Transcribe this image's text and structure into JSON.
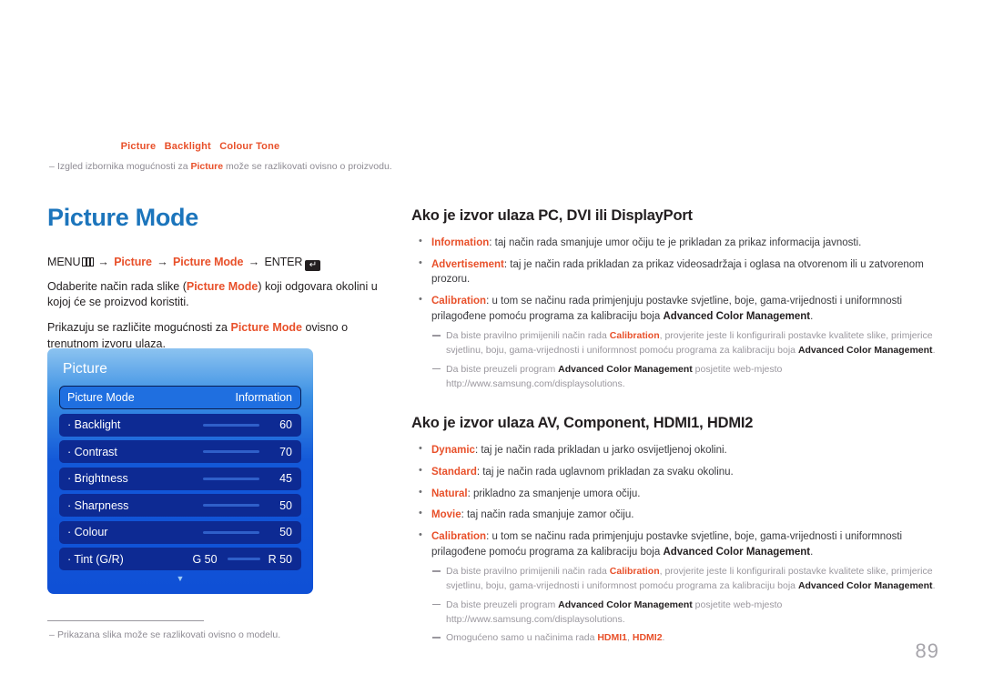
{
  "runhead": {
    "items": [
      "Picture",
      "Backlight",
      "Colour Tone"
    ],
    "color": "#e8502a"
  },
  "topnote": {
    "dash": "–",
    "before": "Izgled izbornika mogućnosti za ",
    "keyword": "Picture",
    "after": " može se razlikovati ovisno o proizvodu."
  },
  "left": {
    "title": "Picture Mode",
    "menu_path": {
      "menu_label": "MENU",
      "menu_icon": "menu-grid-icon",
      "arrow": "→",
      "step1": "Picture",
      "step2": "Picture Mode",
      "enter_label": "ENTER",
      "enter_icon": "enter-key-icon",
      "enter_glyph": "↵"
    },
    "paragraphs": [
      {
        "p1": "Odaberite način rada slike (",
        "kw": "Picture Mode",
        "p2": ") koji odgovara okolini u kojoj će se proizvod koristiti."
      },
      {
        "p1": "Prikazuju se različite mogućnosti za ",
        "kw": "Picture Mode",
        "p2": " ovisno o trenutnom izvoru ulaza."
      }
    ],
    "footnote": {
      "dash": "–",
      "text": "Prikazana slika može se razlikovati ovisno o modelu."
    }
  },
  "osd": {
    "title": "Picture",
    "caret_icon": "chevron-down-icon",
    "caret_glyph": "▼",
    "rows": [
      {
        "label": "Picture Mode",
        "value": "Information",
        "selected": true,
        "has_bar": false
      },
      {
        "label": "· Backlight",
        "value": "60",
        "selected": false,
        "has_bar": true
      },
      {
        "label": "· Contrast",
        "value": "70",
        "selected": false,
        "has_bar": true
      },
      {
        "label": "· Brightness",
        "value": "45",
        "selected": false,
        "has_bar": true
      },
      {
        "label": "· Sharpness",
        "value": "50",
        "selected": false,
        "has_bar": true
      },
      {
        "label": "· Colour",
        "value": "50",
        "selected": false,
        "has_bar": true
      },
      {
        "label": "· Tint (G/R)",
        "value_g": "G 50",
        "value": "R 50",
        "selected": false,
        "has_bar": true,
        "dual": true
      }
    ]
  },
  "right": {
    "section1": {
      "heading": "Ako je izvor ulaza PC, DVI ili DisplayPort",
      "bullets": [
        {
          "term": "Information",
          "text": ": taj način rada smanjuje umor očiju te je prikladan za prikaz informacija javnosti."
        },
        {
          "term": "Advertisement",
          "text": ": taj je način rada prikladan za prikaz videosadržaja i oglasa na otvorenom ili u zatvorenom prozoru."
        },
        {
          "term": "Calibration",
          "text": ": u tom se načinu rada primjenjuju postavke svjetline, boje, gama-vrijednosti i uniformnosti prilagođene pomoću programa za kalibraciju boja ",
          "strong": "Advanced Color Management",
          "text_tail": "."
        }
      ],
      "subnotes": [
        {
          "t1": "Da biste pravilno primijenili način rada ",
          "term": "Calibration",
          "t2": ", provjerite jeste li konfigurirali postavke kvalitete slike, primjerice svjetlinu, boju, gama-vrijednosti i uniformnost pomoću programa za kalibraciju boja ",
          "strong": "Advanced Color Management",
          "t3": "."
        },
        {
          "t1": "Da biste preuzeli program ",
          "strong": "Advanced Color Management",
          "t2": " posjetite web-mjesto http://www.samsung.com/displaysolutions."
        }
      ]
    },
    "section2": {
      "heading": "Ako je izvor ulaza AV, Component, HDMI1, HDMI2",
      "bullets": [
        {
          "term": "Dynamic",
          "text": ": taj je način rada prikladan u jarko osvijetljenoj okolini."
        },
        {
          "term": "Standard",
          "text": ": taj je način rada uglavnom prikladan za svaku okolinu."
        },
        {
          "term": "Natural",
          "text": ": prikladno za smanjenje umora očiju."
        },
        {
          "term": "Movie",
          "text": ": taj način rada smanjuje zamor očiju."
        },
        {
          "term": "Calibration",
          "text": ": u tom se načinu rada primjenjuju postavke svjetline, boje, gama-vrijednosti i uniformnosti prilagođene pomoću programa za kalibraciju boja ",
          "strong": "Advanced Color Management",
          "text_tail": "."
        }
      ],
      "subnotes": [
        {
          "t1": "Da biste pravilno primijenili način rada ",
          "term": "Calibration",
          "t2": ", provjerite jeste li konfigurirali postavke kvalitete slike, primjerice svjetlinu, boju, gama-vrijednosti i uniformnost pomoću programa za kalibraciju boja ",
          "strong": "Advanced Color Management",
          "t3": "."
        },
        {
          "t1": "Da biste preuzeli program ",
          "strong": "Advanced Color Management",
          "t2": " posjetite web-mjesto http://www.samsung.com/displaysolutions."
        },
        {
          "t1": "Omogućeno samo u načinima rada ",
          "term": "HDMI1",
          "t2": ", ",
          "term2": "HDMI2",
          "t3": "."
        }
      ]
    }
  },
  "page_number": "89"
}
